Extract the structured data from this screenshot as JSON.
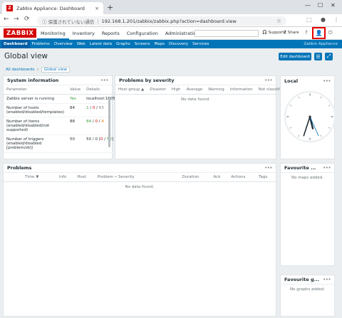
{
  "browser": {
    "tab_title": "Zabbix Appliance: Dashboard",
    "tab_close": "×",
    "new_tab": "+",
    "minimize": "—",
    "maximize": "☐",
    "close": "✕",
    "back": "←",
    "forward": "→",
    "reload": "⟳",
    "url_warning": "ⓘ 保護されていない通信",
    "url_separator": "|",
    "url": "192.168.1.201/zabbix/zabbix.php?action=dashboard.view",
    "star": "☆",
    "ext_icon": "⬚",
    "profile_icon": "●",
    "kebab_icon": "⋮"
  },
  "header": {
    "logo": "ZABBIX",
    "menu": [
      {
        "label": "Monitoring",
        "active": true
      },
      {
        "label": "Inventory"
      },
      {
        "label": "Reports"
      },
      {
        "label": "Configuration"
      },
      {
        "label": "Administration"
      }
    ],
    "support": "Support",
    "share": "Share",
    "help": "?",
    "user_icon": "👤",
    "power_icon": "⏻"
  },
  "subnav": {
    "items": [
      {
        "label": "Dashboard",
        "active": true
      },
      {
        "label": "Problems"
      },
      {
        "label": "Overview"
      },
      {
        "label": "Web"
      },
      {
        "label": "Latest data"
      },
      {
        "label": "Graphs"
      },
      {
        "label": "Screens"
      },
      {
        "label": "Maps"
      },
      {
        "label": "Discovery"
      },
      {
        "label": "Services"
      }
    ],
    "right_text": "Zabbix Appliance"
  },
  "page": {
    "title": "Global view",
    "edit_button": "Edit dashboard",
    "list_icon": "☰",
    "fullscreen_icon": "⤢"
  },
  "breadcrumb": {
    "all": "All dashboards",
    "separator": "/",
    "current": "Global view"
  },
  "widgets": {
    "menu_icon": "•••",
    "sysinfo": {
      "title": "System information",
      "headers": [
        "Parameter",
        "Value",
        "Details"
      ],
      "rows": [
        {
          "param": "Zabbix server is running",
          "value": "Yes",
          "details": "localhost:10051"
        },
        {
          "param": "Number of hosts (enabled/disabled/templates)",
          "value": "84",
          "d1": "1",
          "d2": "0",
          "d3": "83"
        },
        {
          "param": "Number of items (enabled/disabled/not supported)",
          "value": "88",
          "d1": "84",
          "d2": "0",
          "d3": "4"
        },
        {
          "param": "Number of triggers (enabled/disabled [problem/ok])",
          "value": "50",
          "d1": "50",
          "d2": "0",
          "d3": "0",
          "d4": "50"
        }
      ]
    },
    "severity": {
      "title": "Problems by severity",
      "headers": [
        "Host group ▲",
        "Disaster",
        "High",
        "Average",
        "Warning",
        "Information",
        "Not classified"
      ],
      "empty": "No data found."
    },
    "clock": {
      "title": "Local",
      "hour": 5,
      "minute": 33,
      "second": 26
    },
    "problems": {
      "title": "Problems",
      "headers": [
        "Time ▼",
        "Info",
        "Host",
        "Problem • Severity",
        "Duration",
        "Ack",
        "Actions",
        "Tags"
      ],
      "empty": "No data found."
    },
    "favmaps": {
      "title": "Favourite ...",
      "empty": "No maps added."
    },
    "favgraphs": {
      "title": "Favourite g...",
      "empty": "No graphs added."
    }
  }
}
